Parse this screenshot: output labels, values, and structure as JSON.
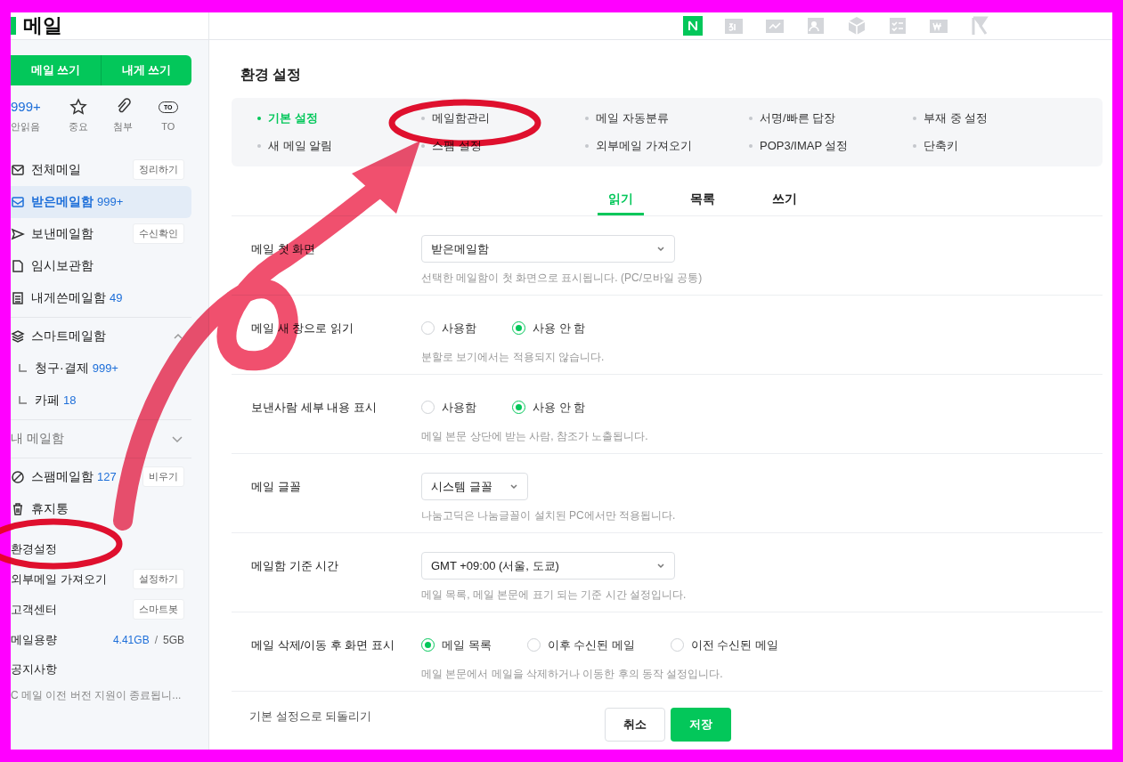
{
  "header": {
    "logo_text": "메일"
  },
  "sidebar": {
    "write_buttons": [
      "메일 쓰기",
      "내게 쓰기"
    ],
    "quick_filters": [
      {
        "kind": "count",
        "value": "999+",
        "label": "안읽음"
      },
      {
        "kind": "icon",
        "label": "중요"
      },
      {
        "kind": "icon",
        "label": "첨부"
      },
      {
        "kind": "badge",
        "value": "TO",
        "label": "TO"
      }
    ],
    "folders": [
      {
        "label": "전체메일",
        "action": "정리하기",
        "selected": false
      },
      {
        "label": "받은메일함",
        "count": "999+",
        "selected": true
      },
      {
        "label": "보낸메일함",
        "action": "수신확인",
        "selected": false
      },
      {
        "label": "임시보관함",
        "selected": false
      },
      {
        "label": "내게쓴메일함",
        "count": "49",
        "selected": false
      }
    ],
    "smart_mailbox": {
      "label": "스마트메일함",
      "expanded": true,
      "children": [
        {
          "label": "청구·결제",
          "count": "999+"
        },
        {
          "label": "카페",
          "count": "18"
        }
      ]
    },
    "my_mailbox": {
      "label": "내 메일함",
      "expanded": false
    },
    "extra_folders": [
      {
        "label": "스팸메일함",
        "count": "127",
        "action": "비우기"
      },
      {
        "label": "휴지통"
      }
    ],
    "links": [
      {
        "label": "환경설정"
      },
      {
        "label": "외부메일 가져오기",
        "action": "설정하기"
      },
      {
        "label": "고객센터",
        "action": "스마트봇"
      }
    ],
    "storage": {
      "label": "메일용량",
      "used": "4.41GB",
      "separator": "/",
      "total": "5GB"
    },
    "notice": {
      "label": "공지사항",
      "text": "C 메일 이전 버전 지원이 종료됩니..."
    }
  },
  "page_title": "환경 설정",
  "settings_nav": [
    {
      "label": "기본 설정",
      "selected": true
    },
    {
      "label": "메일함관리",
      "selected": false
    },
    {
      "label": "메일 자동분류",
      "selected": false
    },
    {
      "label": "서명/빠른 답장",
      "selected": false
    },
    {
      "label": "부재 중 설정",
      "selected": false
    },
    {
      "label": "새 메일 알림",
      "selected": false
    },
    {
      "label": "스팸 설정",
      "selected": false
    },
    {
      "label": "외부메일 가져오기",
      "selected": false
    },
    {
      "label": "POP3/IMAP 설정",
      "selected": false
    },
    {
      "label": "단축키",
      "selected": false
    }
  ],
  "tabs": [
    {
      "label": "읽기",
      "selected": true
    },
    {
      "label": "목록",
      "selected": false
    },
    {
      "label": "쓰기",
      "selected": false
    }
  ],
  "rows": [
    {
      "kind": "select",
      "label": "메일 첫 화면",
      "value": "받은메일함",
      "compact": false,
      "hint": "선택한 메일함이 첫 화면으로 표시됩니다. (PC/모바일 공통)"
    },
    {
      "kind": "radio",
      "label": "메일 새 창으로 읽기",
      "options": [
        {
          "label": "사용함",
          "selected": false
        },
        {
          "label": "사용 안 함",
          "selected": true
        }
      ],
      "hint": "분할로 보기에서는 적용되지 않습니다."
    },
    {
      "kind": "radio",
      "label": "보낸사람 세부 내용 표시",
      "options": [
        {
          "label": "사용함",
          "selected": false
        },
        {
          "label": "사용 안 함",
          "selected": true
        }
      ],
      "hint": "메일 본문 상단에 받는 사람, 참조가 노출됩니다."
    },
    {
      "kind": "select",
      "label": "메일 글꼴",
      "value": "시스템 글꼴",
      "compact": true,
      "hint": "나눔고딕은 나눔글꼴이 설치된 PC에서만 적용됩니다."
    },
    {
      "kind": "select",
      "label": "메일함 기준 시간",
      "value": "GMT +09:00 (서울, 도쿄)",
      "compact": false,
      "hint": "메일 목록, 메일 본문에 표기 되는 기준 시간 설정입니다."
    },
    {
      "kind": "radio",
      "label": "메일 삭제/이동 후 화면 표시",
      "options": [
        {
          "label": "메일 목록",
          "selected": true
        },
        {
          "label": "이후 수신된 메일",
          "selected": false
        },
        {
          "label": "이전 수신된 메일",
          "selected": false
        }
      ],
      "hint": "메일 본문에서 메일을 삭제하거나 이동한 후의 동작 설정입니다."
    }
  ],
  "footer": {
    "reset_link": "기본 설정으로 되돌리기",
    "buttons": [
      {
        "label": "취소",
        "kind": "secondary"
      },
      {
        "label": "저장",
        "kind": "primary"
      }
    ]
  }
}
